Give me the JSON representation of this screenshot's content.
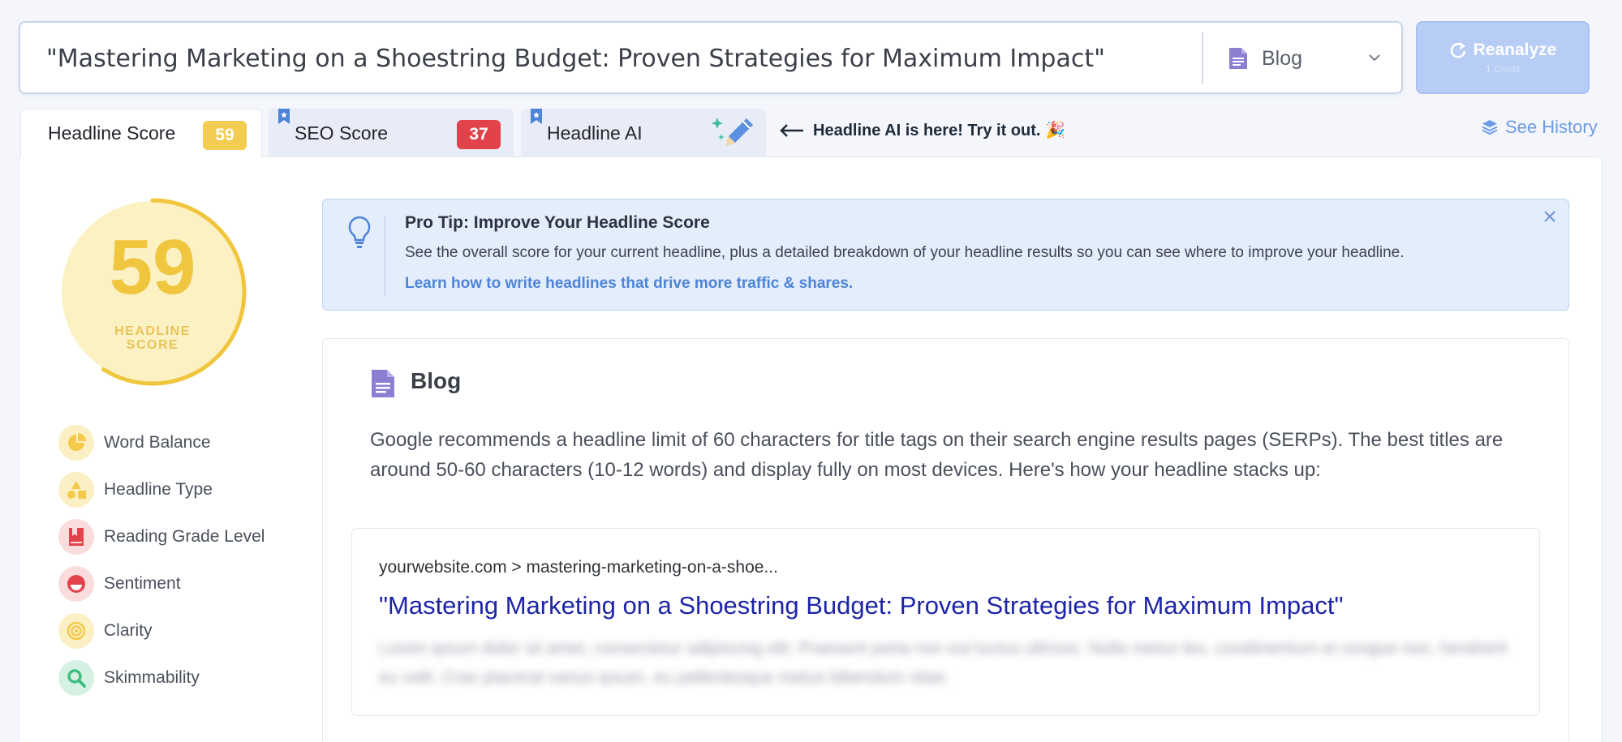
{
  "search": {
    "headline_value": "\"Mastering Marketing on a Shoestring Budget: Proven Strategies for Maximum Impact\"",
    "type_label": "Blog"
  },
  "reanalyze": {
    "label": "Reanalyze",
    "sublabel": "1 Credit"
  },
  "tabs": [
    {
      "label": "Headline Score",
      "badge": "59"
    },
    {
      "label": "SEO Score",
      "badge": "37"
    },
    {
      "label": "Headline AI"
    }
  ],
  "ai_note": "Headline AI is here! Try it out. 🎉",
  "see_history": "See History",
  "score": {
    "value": "59",
    "caption_line1": "HEADLINE",
    "caption_line2": "SCORE",
    "fraction": 0.59,
    "color": "#f0c63e"
  },
  "metrics": [
    {
      "label": "Word Balance",
      "icon": "pie-chart-icon",
      "color": "#f4c94c"
    },
    {
      "label": "Headline Type",
      "icon": "shapes-icon",
      "color": "#f4c94c"
    },
    {
      "label": "Reading Grade Level",
      "icon": "book-icon",
      "color": "#e2434a"
    },
    {
      "label": "Sentiment",
      "icon": "sentiment-icon",
      "color": "#e2434a"
    },
    {
      "label": "Clarity",
      "icon": "target-icon",
      "color": "#f4c94c"
    },
    {
      "label": "Skimmability",
      "icon": "magnifier-icon",
      "color": "#3fbf7f"
    }
  ],
  "pro_tip": {
    "title": "Pro Tip: Improve Your Headline Score",
    "body": "See the overall score for your current headline, plus a detailed breakdown of your headline results so you can see where to improve your headline.",
    "link": "Learn how to write headlines that drive more traffic & shares."
  },
  "blog": {
    "title": "Blog",
    "description": "Google recommends a headline limit of 60 characters for title tags on their search engine results pages (SERPs). The best titles are around 50-60 characters (10-12 words) and display fully on most devices. Here's how your headline stacks up:",
    "serp": {
      "url": "yourwebsite.com > mastering-marketing-on-a-shoe...",
      "title": "\"Mastering Marketing on a Shoestring Budget: Proven Strategies for Maximum Impact\"",
      "desc_blurred": "Lorem ipsum dolor sit amet, consectetur adipiscing elit. Praesent porta non est luctus ultrices. Nulla metus leo, condimentum et congue non, hendrerit eu velit. Cras placerat varius ipsum, eu pellentesque metus bibendum vitae."
    }
  },
  "colors": {
    "accent_blue": "#4e84d8",
    "score_yellow": "#f3cc52",
    "seo_red": "#e2434a",
    "serp_title": "#1d24a8"
  }
}
